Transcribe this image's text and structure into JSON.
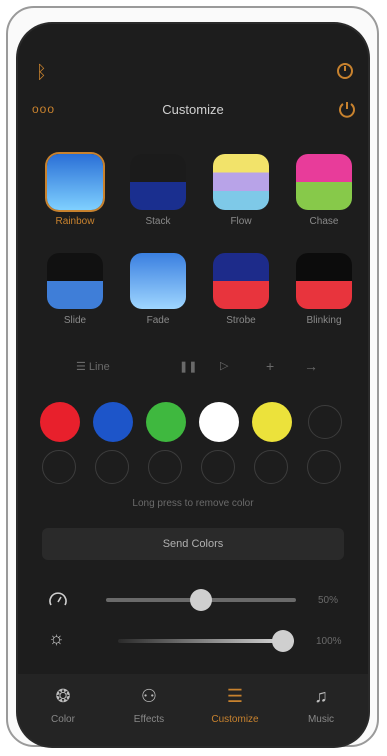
{
  "header": {
    "title": "Customize",
    "left_top_icon": "bluetooth-icon",
    "right_top_icon": "timer-icon",
    "menu_label": "ooo",
    "power_icon": "power-icon"
  },
  "modes": [
    {
      "label": "Rainbow",
      "colors": [
        "#2a6fd6",
        "#7fd0ff"
      ]
    },
    {
      "label": "Stack",
      "colors": [
        "#1b1b1b",
        "#1a2f8f"
      ]
    },
    {
      "label": "Flow",
      "colors": [
        "#f2e36a",
        "#b8a3e8",
        "#7ec9e8"
      ]
    },
    {
      "label": "Chase",
      "colors": [
        "#e83c9a",
        "#87c94a"
      ]
    },
    {
      "label": "Slide",
      "colors": [
        "#111111",
        "#3f7ed8"
      ]
    },
    {
      "label": "Fade",
      "colors": [
        "#3a7fe0",
        "#9fd6ff"
      ]
    },
    {
      "label": "Strobe",
      "colors": [
        "#1d2b8a",
        "#e8343d"
      ]
    },
    {
      "label": "Blinking",
      "colors": [
        "#0c0c0c",
        "#e8343d"
      ]
    }
  ],
  "toolbar": {
    "line_label": "Line",
    "pause_icon": "pause-icon",
    "play_icon": "play-icon",
    "add_icon": "plus-icon",
    "next_icon": "arrow-right-icon"
  },
  "colors": [
    "#e8202c",
    "#1d55c9",
    "#3fb83f",
    "#ffffff",
    "#ece23b"
  ],
  "hint": "Long press to remove color",
  "send_button": "Send Colors",
  "speed": {
    "value": 50,
    "label": "50%"
  },
  "brightness": {
    "value": 100,
    "label": "100%"
  },
  "nav": [
    {
      "label": "Color",
      "icon": "palette-icon"
    },
    {
      "label": "Effects",
      "icon": "effects-icon"
    },
    {
      "label": "Customize",
      "icon": "customize-icon",
      "active": true
    },
    {
      "label": "Music",
      "icon": "music-icon"
    }
  ]
}
